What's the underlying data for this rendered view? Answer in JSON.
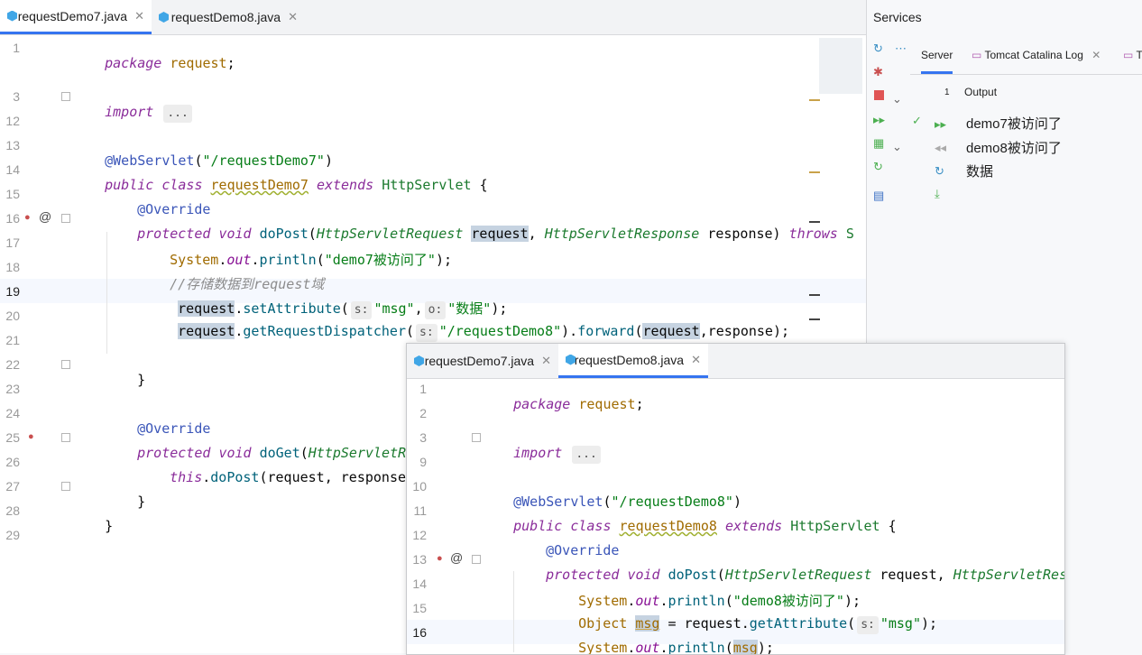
{
  "editor1": {
    "tabs": [
      {
        "label": "requestDemo7.java",
        "active": true
      },
      {
        "label": "requestDemo8.java",
        "active": false
      }
    ],
    "line_numbers": [
      "1",
      "3",
      "12",
      "13",
      "14",
      "15",
      "16",
      "17",
      "18",
      "19",
      "20",
      "21",
      "22",
      "23",
      "24",
      "25",
      "26",
      "27",
      "28",
      "29"
    ],
    "current_line": "19",
    "code": {
      "l1_kw": "package",
      "l1_pkg": "request",
      "l1_end": ";",
      "l3_kw": "import",
      "l3_fold": "...",
      "l13_ann": "@WebServlet",
      "l13_open": "(",
      "l13_str": "\"/requestDemo7\"",
      "l13_close": ")",
      "l14_kw1": "public",
      "l14_kw2": "class",
      "l14_name": "requestDemo7",
      "l14_kw3": "extends",
      "l14_super": "HttpServlet",
      "l14_brace": "{",
      "l15_ann": "@Override",
      "l16_kw1": "protected",
      "l16_kw2": "void",
      "l16_fn": "doPost",
      "l16_p1type": "HttpServletRequest",
      "l16_p1": "request",
      "l16_comma": ",",
      "l16_p2type": "HttpServletResponse",
      "l16_p2": "response)",
      "l16_throws": "throws",
      "l16_tail": "S",
      "l17_cls": "System",
      "l17_dot1": ".",
      "l17_field": "out",
      "l17_dot2": ".",
      "l17_fn": "println",
      "l17_open": "(",
      "l17_str": "\"demo7被访问了\"",
      "l17_close": ");",
      "l18_cmt": "//存储数据到request域",
      "l19_obj": "request",
      "l19_dot": ".",
      "l19_fn": "setAttribute",
      "l19_open": "(",
      "l19_hint1": "s:",
      "l19_str1": "\"msg\"",
      "l19_comma": ",",
      "l19_hint2": "o:",
      "l19_str2": "\"数据\"",
      "l19_close": ");",
      "l20_obj": "request",
      "l20_dot": ".",
      "l20_fn": "getRequestDispatcher",
      "l20_open": "(",
      "l20_hint": "s:",
      "l20_str": "\"/requestDemo8\"",
      "l20_mid": ").",
      "l20_fn2": "forward",
      "l20_open2": "(",
      "l20_arg1": "request",
      "l20_rest": ",response);",
      "l22_brace": "}",
      "l24_ann": "@Override",
      "l25_kw1": "protected",
      "l25_kw2": "void",
      "l25_fn": "doGet",
      "l25_open": "(",
      "l25_ptype": "HttpServletReque",
      "l26_this": "this",
      "l26_dot": ".",
      "l26_fn": "doPost",
      "l26_rest": "(request, response);",
      "l27_brace": "}",
      "l28_brace": "}"
    }
  },
  "editor2": {
    "tabs": [
      {
        "label": "requestDemo7.java",
        "active": false
      },
      {
        "label": "requestDemo8.java",
        "active": true
      }
    ],
    "line_numbers": [
      "1",
      "2",
      "3",
      "9",
      "10",
      "11",
      "12",
      "13",
      "14",
      "15",
      "16"
    ],
    "current_line": "16",
    "code": {
      "l1_kw": "package",
      "l1_pkg": "request",
      "l1_end": ";",
      "l3_kw": "import",
      "l3_fold": "...",
      "l10_ann": "@WebServlet",
      "l10_open": "(",
      "l10_str": "\"/requestDemo8\"",
      "l10_close": ")",
      "l11_kw1": "public",
      "l11_kw2": "class",
      "l11_name": "requestDemo8",
      "l11_kw3": "extends",
      "l11_super": "HttpServlet",
      "l11_brace": "{",
      "l12_ann": "@Override",
      "l13_kw1": "protected",
      "l13_kw2": "void",
      "l13_fn": "doPost",
      "l13_open": "(",
      "l13_p1type": "HttpServletRequest",
      "l13_p1": "request,",
      "l13_p2type": "HttpServletRespons",
      "l14_cls": "System",
      "l14_dot1": ".",
      "l14_field": "out",
      "l14_dot2": ".",
      "l14_fn": "println",
      "l14_open": "(",
      "l14_str": "\"demo8被访问了\"",
      "l14_close": ");",
      "l15_type": "Object",
      "l15_var": "msg",
      "l15_eq": "=",
      "l15_obj": "request",
      "l15_dot": ".",
      "l15_fn": "getAttribute",
      "l15_open": "(",
      "l15_hint": "s:",
      "l15_str": "\"msg\"",
      "l15_close": ");",
      "l16_cls": "System",
      "l16_dot1": ".",
      "l16_field": "out",
      "l16_dot2": ".",
      "l16_fn": "println",
      "l16_open": "(",
      "l16_var": "msg",
      "l16_close": ");"
    }
  },
  "services": {
    "title": "Services",
    "tabs": [
      "Server",
      "Tomcat Catalina Log",
      "T"
    ],
    "output_label": "Output",
    "output_count": "1",
    "output_lines": [
      "demo7被访问了",
      "demo8被访问了",
      "数据"
    ]
  },
  "colors": {
    "accent": "#3574f0",
    "keyword": "#8a2c9a",
    "string": "#067d17",
    "annotation": "#3a55b8",
    "java_icon": "#40a6e6"
  }
}
